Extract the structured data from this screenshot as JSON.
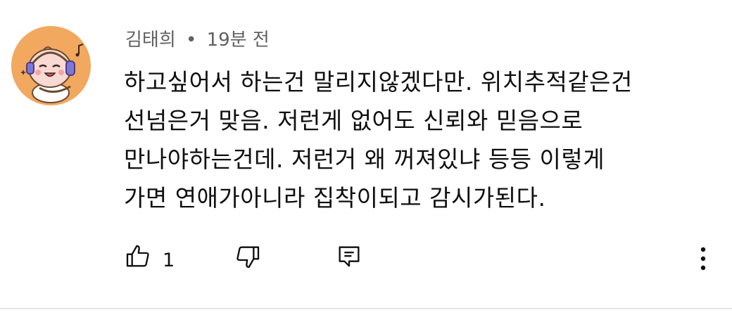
{
  "comment": {
    "author": "김태희",
    "separator": "•",
    "time": "19분 전",
    "lines": [
      "하고싶어서 하는건 말리지않겠다만. 위치추적같은건",
      "선넘은거 맞음. 저런게 없어도 신뢰와 믿음으로",
      "만나야하는건데. 저런거 왜 꺼져있냐 등등 이렇게",
      "가면 연애가아니라 집착이되고 감시가된다."
    ]
  },
  "actions": {
    "like_count": "1",
    "icons": [
      "thumbs-up-icon",
      "thumbs-down-icon",
      "reply-icon",
      "more-vert-icon"
    ]
  },
  "colors": {
    "avatar_bg": "#f2a85f",
    "meta_text": "#606060",
    "body_text": "#0f0f0f",
    "divider": "#e5e5e5"
  }
}
